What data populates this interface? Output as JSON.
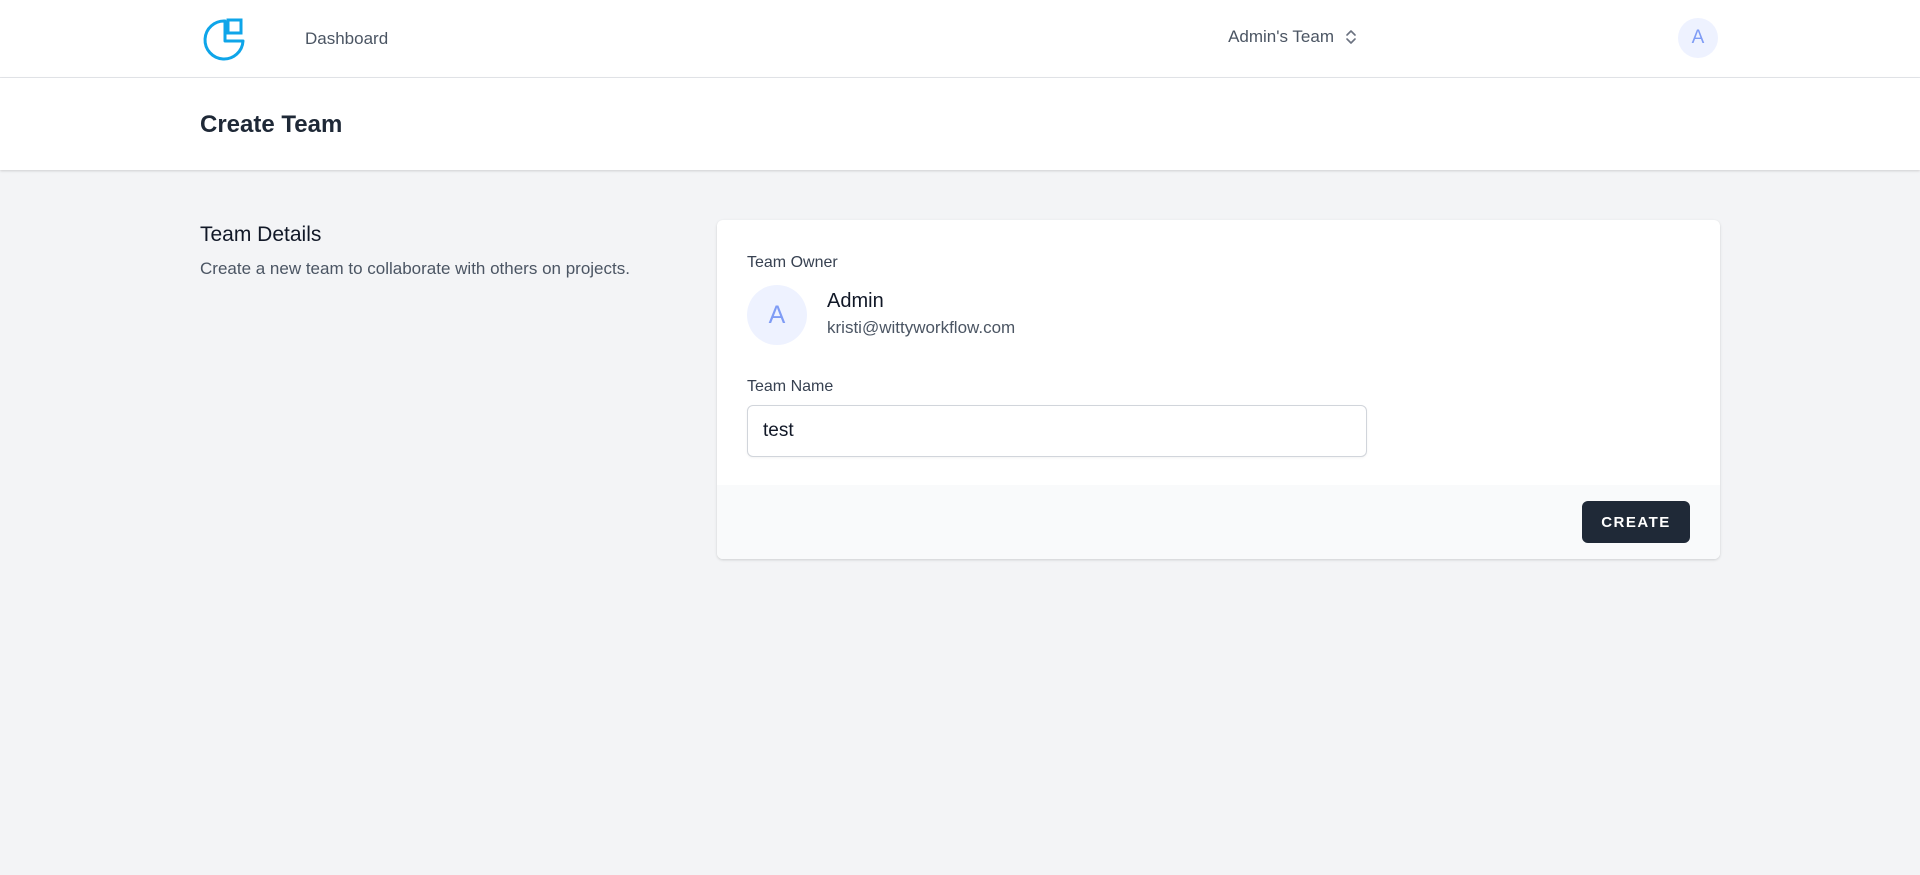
{
  "nav": {
    "logo_icon": "logo-icon",
    "links": [
      {
        "label": "Dashboard"
      }
    ],
    "team_switcher": {
      "label": "Admin's Team",
      "icon": "chevron-up-down-icon"
    },
    "user_avatar": "A"
  },
  "header": {
    "title": "Create Team"
  },
  "section": {
    "title": "Team Details",
    "description": "Create a new team to collaborate with others on projects."
  },
  "form": {
    "owner_label": "Team Owner",
    "owner": {
      "initial": "A",
      "name": "Admin",
      "email": "kristi@wittyworkflow.com"
    },
    "team_name_label": "Team Name",
    "team_name_value": "test",
    "submit_label": "CREATE"
  },
  "colors": {
    "accent": "#0ea5e9",
    "button_bg": "#1f2937",
    "page_bg": "#f3f4f6",
    "avatar_bg": "#eef2ff",
    "avatar_text": "#7f9cf5"
  }
}
